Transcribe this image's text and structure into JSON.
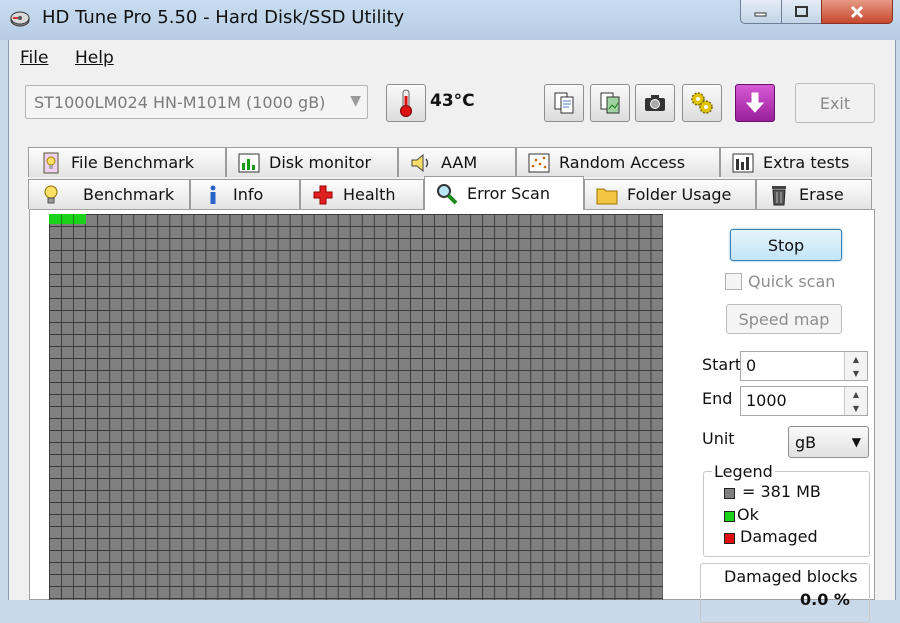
{
  "window": {
    "title": "HD Tune Pro 5.50 - Hard Disk/SSD Utility"
  },
  "menu": {
    "items": [
      {
        "label": "File",
        "underline": "F"
      },
      {
        "label": "Help",
        "underline": "H"
      }
    ]
  },
  "toolbar": {
    "drive": "ST1000LM024 HN-M101M (1000 gB)",
    "temperature": "43°C",
    "exit_label": "Exit"
  },
  "tabs": {
    "row1": [
      "File Benchmark",
      "Disk monitor",
      "AAM",
      "Random Access",
      "Extra tests"
    ],
    "row2": [
      "Benchmark",
      "Info",
      "Health",
      "Error Scan",
      "Folder Usage",
      "Erase"
    ],
    "active": "Error Scan"
  },
  "controls": {
    "stop_label": "Stop",
    "quick_scan_label": "Quick scan",
    "speed_map_label": "Speed map",
    "start_label": "Start",
    "start_value": "0",
    "end_label": "End",
    "end_value": "1000",
    "unit_label": "Unit",
    "unit_value": "gB"
  },
  "legend": {
    "title": "Legend",
    "items": [
      {
        "label": "= 381 MB",
        "color": "#808080"
      },
      {
        "label": "Ok",
        "color": "#1bd21b"
      },
      {
        "label": "Damaged",
        "color": "#e01010"
      }
    ]
  },
  "damaged_blocks": {
    "title": "Damaged blocks",
    "value": "0.0 %"
  },
  "colors": {
    "block_unscanned": "#808080",
    "block_ok": "#1bd21b",
    "block_damaged": "#e01010",
    "accent": "#3c7fb1"
  }
}
